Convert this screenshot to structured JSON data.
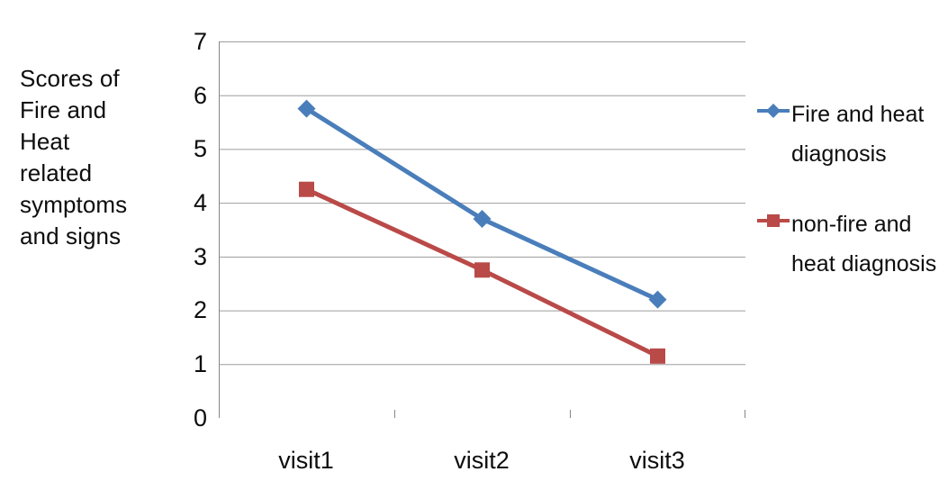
{
  "chart_data": {
    "type": "line",
    "title": "",
    "subtitle": "",
    "xlabel": "",
    "ylabel": "Scores of Fire and Heat related symptoms and signs",
    "categories": [
      "visit1",
      "visit2",
      "visit3"
    ],
    "series": [
      {
        "name": "Fire and heat diagnosis",
        "values": [
          5.75,
          3.7,
          2.2
        ],
        "color": "#4A7EBB",
        "marker": "diamond"
      },
      {
        "name": "non-fire and heat diagnosis",
        "values": [
          4.25,
          2.75,
          1.15
        ],
        "color": "#B94A48",
        "marker": "square"
      }
    ],
    "ylim": [
      0,
      7
    ],
    "y_ticks": [
      0,
      1,
      2,
      3,
      4,
      5,
      6,
      7
    ],
    "y_tick_labels": [
      "0",
      "1",
      "2",
      "3",
      "4",
      "5",
      "6",
      "7"
    ],
    "grid": "horizontal",
    "legend_position": "right"
  },
  "axis": {
    "y_title_text": "Scores of\nFire and\nHeat\nrelated\nsymptoms\nand signs",
    "y_tick_labels": [
      "7",
      "6",
      "5",
      "4",
      "3",
      "2",
      "1",
      "0"
    ],
    "x_tick_labels": [
      "visit1",
      "visit2",
      "visit3"
    ]
  },
  "legend": {
    "entries": [
      {
        "label": "Fire and heat diagnosis",
        "color": "#4A7EBB",
        "marker": "diamond"
      },
      {
        "label": "non-fire and heat diagnosis",
        "color": "#B94A48",
        "marker": "square"
      }
    ]
  },
  "colors": {
    "series_blue": "#4A7EBB",
    "series_red": "#B94A48",
    "gridline": "#9E9E9E",
    "axis_line": "#868686",
    "text": "#0D0D0D",
    "background": "#FFFFFF"
  }
}
